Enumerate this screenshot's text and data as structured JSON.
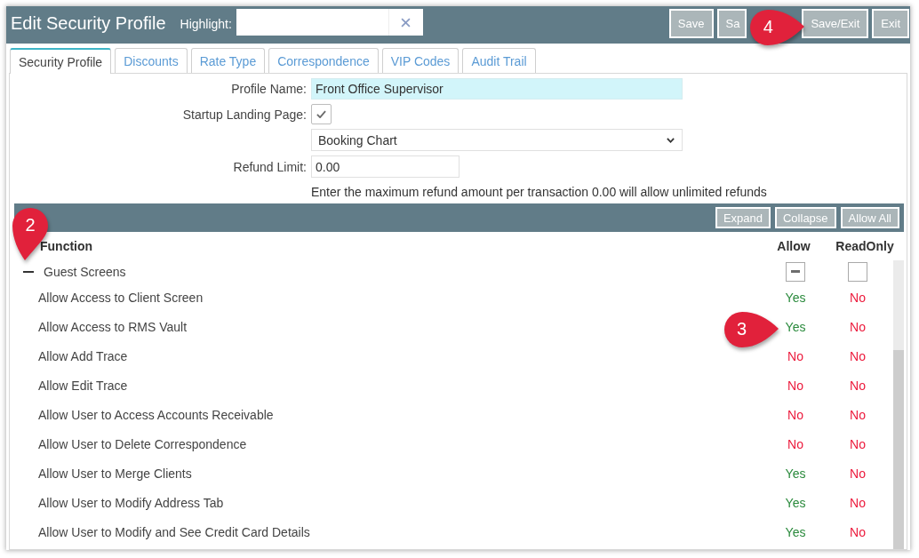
{
  "window": {
    "title": "Edit Security Profile"
  },
  "highlight": {
    "label": "Highlight:"
  },
  "header_buttons": [
    {
      "label": "Save"
    },
    {
      "label": "Sa"
    },
    {
      "label": "Save/Exit",
      "callout": "4"
    },
    {
      "label": "Exit"
    }
  ],
  "tabs": [
    {
      "label": "Security Profile",
      "selected": true
    },
    {
      "label": "Discounts",
      "selected": false
    },
    {
      "label": "Rate Type",
      "selected": false
    },
    {
      "label": "Correspondence",
      "selected": false
    },
    {
      "label": "VIP Codes",
      "selected": false
    },
    {
      "label": "Audit Trail",
      "selected": false
    }
  ],
  "form": {
    "fields": [
      {
        "kind": "text",
        "label": "Profile Name:",
        "value": "Front Office Supervisor",
        "required": true
      },
      {
        "kind": "checkbox",
        "label": "Startup Landing Page:",
        "checked": true
      },
      {
        "kind": "select",
        "value": "Booking Chart"
      },
      {
        "kind": "number",
        "label": "Refund Limit:",
        "value": "0.00",
        "required": false
      },
      {
        "kind": "hint",
        "text": "Enter the maximum refund amount per transaction 0.00 will allow unlimited refunds"
      }
    ]
  },
  "grid": {
    "toolbar_buttons": [
      "Expand",
      "Collapse",
      "Allow All"
    ],
    "columns": [
      "Function",
      "Allow",
      "ReadOnly"
    ],
    "groups": [
      {
        "label": "Guest Screens",
        "expanded": true,
        "callout": "2",
        "allow_checkbox": {
          "mixed": true
        },
        "read_only_checkbox": {
          "checked": false
        },
        "rows": [
          {
            "name": "Allow Access to Client Screen",
            "allow": {
              "label": "Yes",
              "on": true
            },
            "read_only": {
              "label": "No",
              "on": false
            }
          },
          {
            "name": "Allow Access to RMS Vault",
            "allow": {
              "label": "Yes",
              "on": true,
              "callout": "3"
            },
            "read_only": {
              "label": "No",
              "on": false
            }
          },
          {
            "name": "Allow Add Trace",
            "allow": {
              "label": "No",
              "on": false
            },
            "read_only": {
              "label": "No",
              "on": false
            }
          },
          {
            "name": "Allow Edit Trace",
            "allow": {
              "label": "No",
              "on": false
            },
            "read_only": {
              "label": "No",
              "on": false
            }
          },
          {
            "name": "Allow User to Access Accounts Receivable",
            "allow": {
              "label": "No",
              "on": false
            },
            "read_only": {
              "label": "No",
              "on": false
            }
          },
          {
            "name": "Allow User to Delete Correspondence",
            "allow": {
              "label": "No",
              "on": false
            },
            "read_only": {
              "label": "No",
              "on": false
            }
          },
          {
            "name": "Allow User to Merge Clients",
            "allow": {
              "label": "Yes",
              "on": true
            },
            "read_only": {
              "label": "No",
              "on": false
            }
          },
          {
            "name": "Allow User to Modify Address Tab",
            "allow": {
              "label": "Yes",
              "on": true
            },
            "read_only": {
              "label": "No",
              "on": false
            }
          },
          {
            "name": "Allow User to Modify and See Credit Card Details",
            "allow": {
              "label": "Yes",
              "on": true
            },
            "read_only": {
              "label": "No",
              "on": false
            }
          }
        ]
      }
    ]
  }
}
